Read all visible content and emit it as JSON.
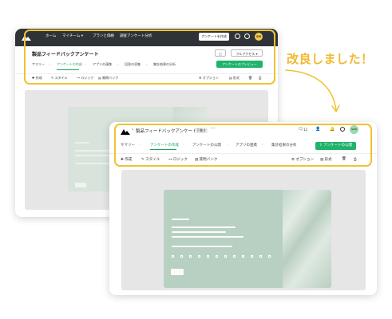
{
  "callout": {
    "text": "改良しました！"
  },
  "colors": {
    "highlight": "#f1c232",
    "accent": "#1fb36b",
    "header_dark": "#2f3338"
  },
  "old": {
    "nav": {
      "home": "ホーム",
      "mysurvey": "マイチーム ▾",
      "plans": "プランと価格",
      "analysis": "調査アンケート分析"
    },
    "create_button": "アンケートを作成",
    "avatar_initials": "SM",
    "title": "製品フィードバックアンケート",
    "ctl_icon": "▢",
    "full_access": "フルアクセス ▾",
    "tabs": [
      "サマリー",
      "アンケートの作成",
      "アプリの連携",
      "回答の収集",
      "集計結果の分析"
    ],
    "preview_button": "アンケートのプレビュー",
    "tools": [
      "✚ 作成",
      "✎ スタイル",
      "⊶ ロジック",
      "▤ 質問バンク"
    ],
    "right_tools": [
      "⚙ オプション",
      "▤ 形式"
    ]
  },
  "new": {
    "breadcrumb_title": "製品フィードバックアンケート",
    "badge": "下書き",
    "comment_count": "12",
    "avatar_initials": "SAN",
    "tabs": [
      "サマリー",
      "アンケートの作成",
      "アンケートの公開",
      "アプリの連携",
      "集計結果の分析"
    ],
    "publish_button": "アンケートの公開",
    "tools": [
      "✚ 作成",
      "✎ スタイル",
      "⊶ ロジック",
      "▤ 質問バンク"
    ],
    "right_tools": [
      "⚙ オプション",
      "▤ 形式"
    ]
  }
}
